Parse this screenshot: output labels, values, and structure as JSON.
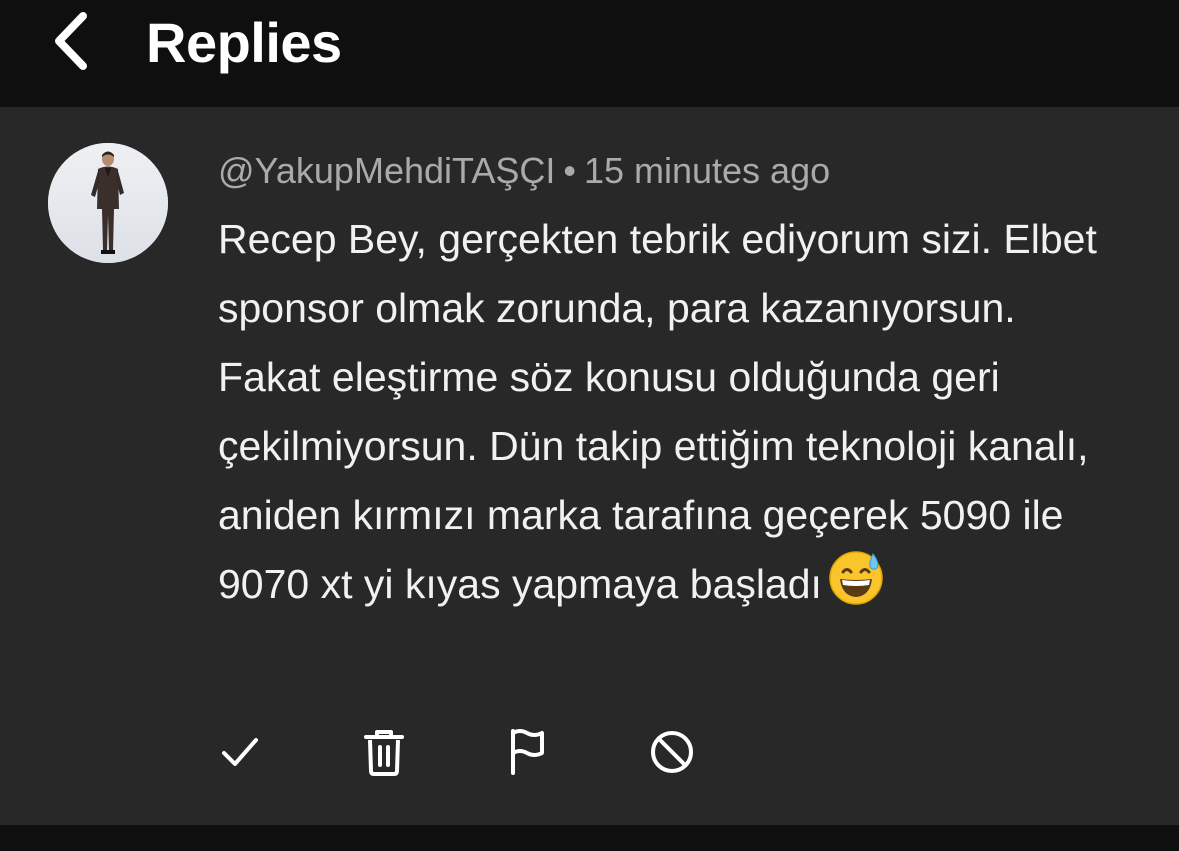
{
  "header": {
    "title": "Replies",
    "back_icon": "chevron-left-icon"
  },
  "comment": {
    "author": "@YakupMehdiTAŞÇI",
    "separator": "•",
    "time": "15 minutes ago",
    "text": "Recep Bey, gerçekten tebrik ediyorum sizi. Elbet sponsor olmak zorunda, para kazanıyorsun. Fakat eleştirme söz konusu olduğunda geri çekilmiyorsun. Dün takip ettiğim teknoloji kanalı, aniden kırmızı marka tarafına geçerek 5090 ile 9070 xt yi kıyas yapmaya başladı",
    "emoji": "grinning-face-with-sweat-emoji"
  },
  "actions": [
    {
      "name": "approve",
      "icon": "checkmark-icon"
    },
    {
      "name": "delete",
      "icon": "trash-icon"
    },
    {
      "name": "report",
      "icon": "flag-icon"
    },
    {
      "name": "block",
      "icon": "block-icon"
    }
  ],
  "colors": {
    "background": "#0f0f0f",
    "card": "#282828",
    "text": "#f1f1f1",
    "meta": "#aaaaaa",
    "emoji": "#f9c52b"
  }
}
